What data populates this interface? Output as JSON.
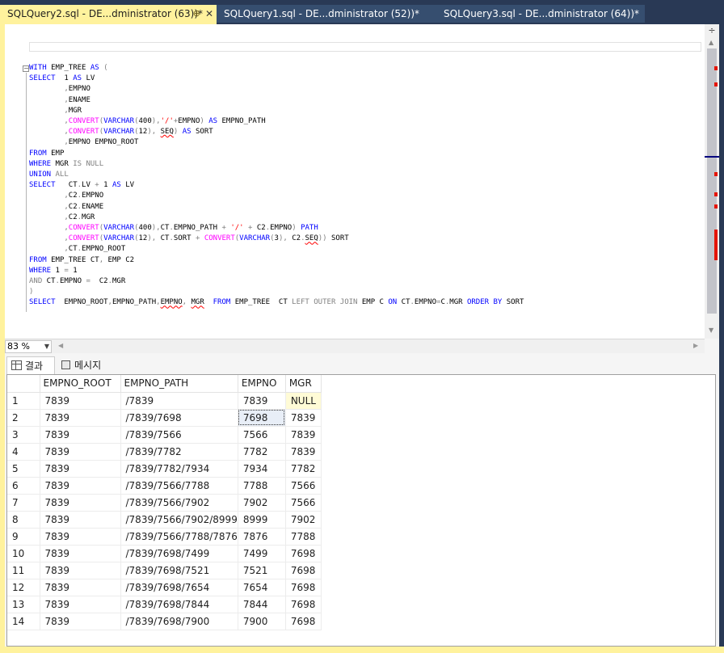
{
  "tabs": [
    {
      "label": "SQLQuery2.sql - DE...dministrator (63))*",
      "active": true
    },
    {
      "label": "SQLQuery1.sql - DE...dministrator (52))*",
      "active": false
    },
    {
      "label": "SQLQuery3.sql - DE...dministrator (64))*",
      "active": false
    }
  ],
  "zoom": "83 %",
  "results_tabs": {
    "results": "결과",
    "messages": "메시지"
  },
  "grid": {
    "columns": [
      "EMPNO_ROOT",
      "EMPNO_PATH",
      "EMPNO",
      "MGR"
    ],
    "rows": [
      [
        "1",
        "7839",
        "/7839",
        "7839",
        "NULL"
      ],
      [
        "2",
        "7839",
        "/7839/7698",
        "7698",
        "7839"
      ],
      [
        "3",
        "7839",
        "/7839/7566",
        "7566",
        "7839"
      ],
      [
        "4",
        "7839",
        "/7839/7782",
        "7782",
        "7839"
      ],
      [
        "5",
        "7839",
        "/7839/7782/7934",
        "7934",
        "7782"
      ],
      [
        "6",
        "7839",
        "/7839/7566/7788",
        "7788",
        "7566"
      ],
      [
        "7",
        "7839",
        "/7839/7566/7902",
        "7902",
        "7566"
      ],
      [
        "8",
        "7839",
        "/7839/7566/7902/8999",
        "8999",
        "7902"
      ],
      [
        "9",
        "7839",
        "/7839/7566/7788/7876",
        "7876",
        "7788"
      ],
      [
        "10",
        "7839",
        "/7839/7698/7499",
        "7499",
        "7698"
      ],
      [
        "11",
        "7839",
        "/7839/7698/7521",
        "7521",
        "7698"
      ],
      [
        "12",
        "7839",
        "/7839/7698/7654",
        "7654",
        "7698"
      ],
      [
        "13",
        "7839",
        "/7839/7698/7844",
        "7844",
        "7698"
      ],
      [
        "14",
        "7839",
        "/7839/7698/7900",
        "7900",
        "7698"
      ]
    ]
  },
  "colors": {
    "accent_tab": "#fff29d",
    "frame": "#293955",
    "keyword": "#0000ff",
    "function": "#ff00ff",
    "string": "#ff0000",
    "operator": "#808080"
  }
}
